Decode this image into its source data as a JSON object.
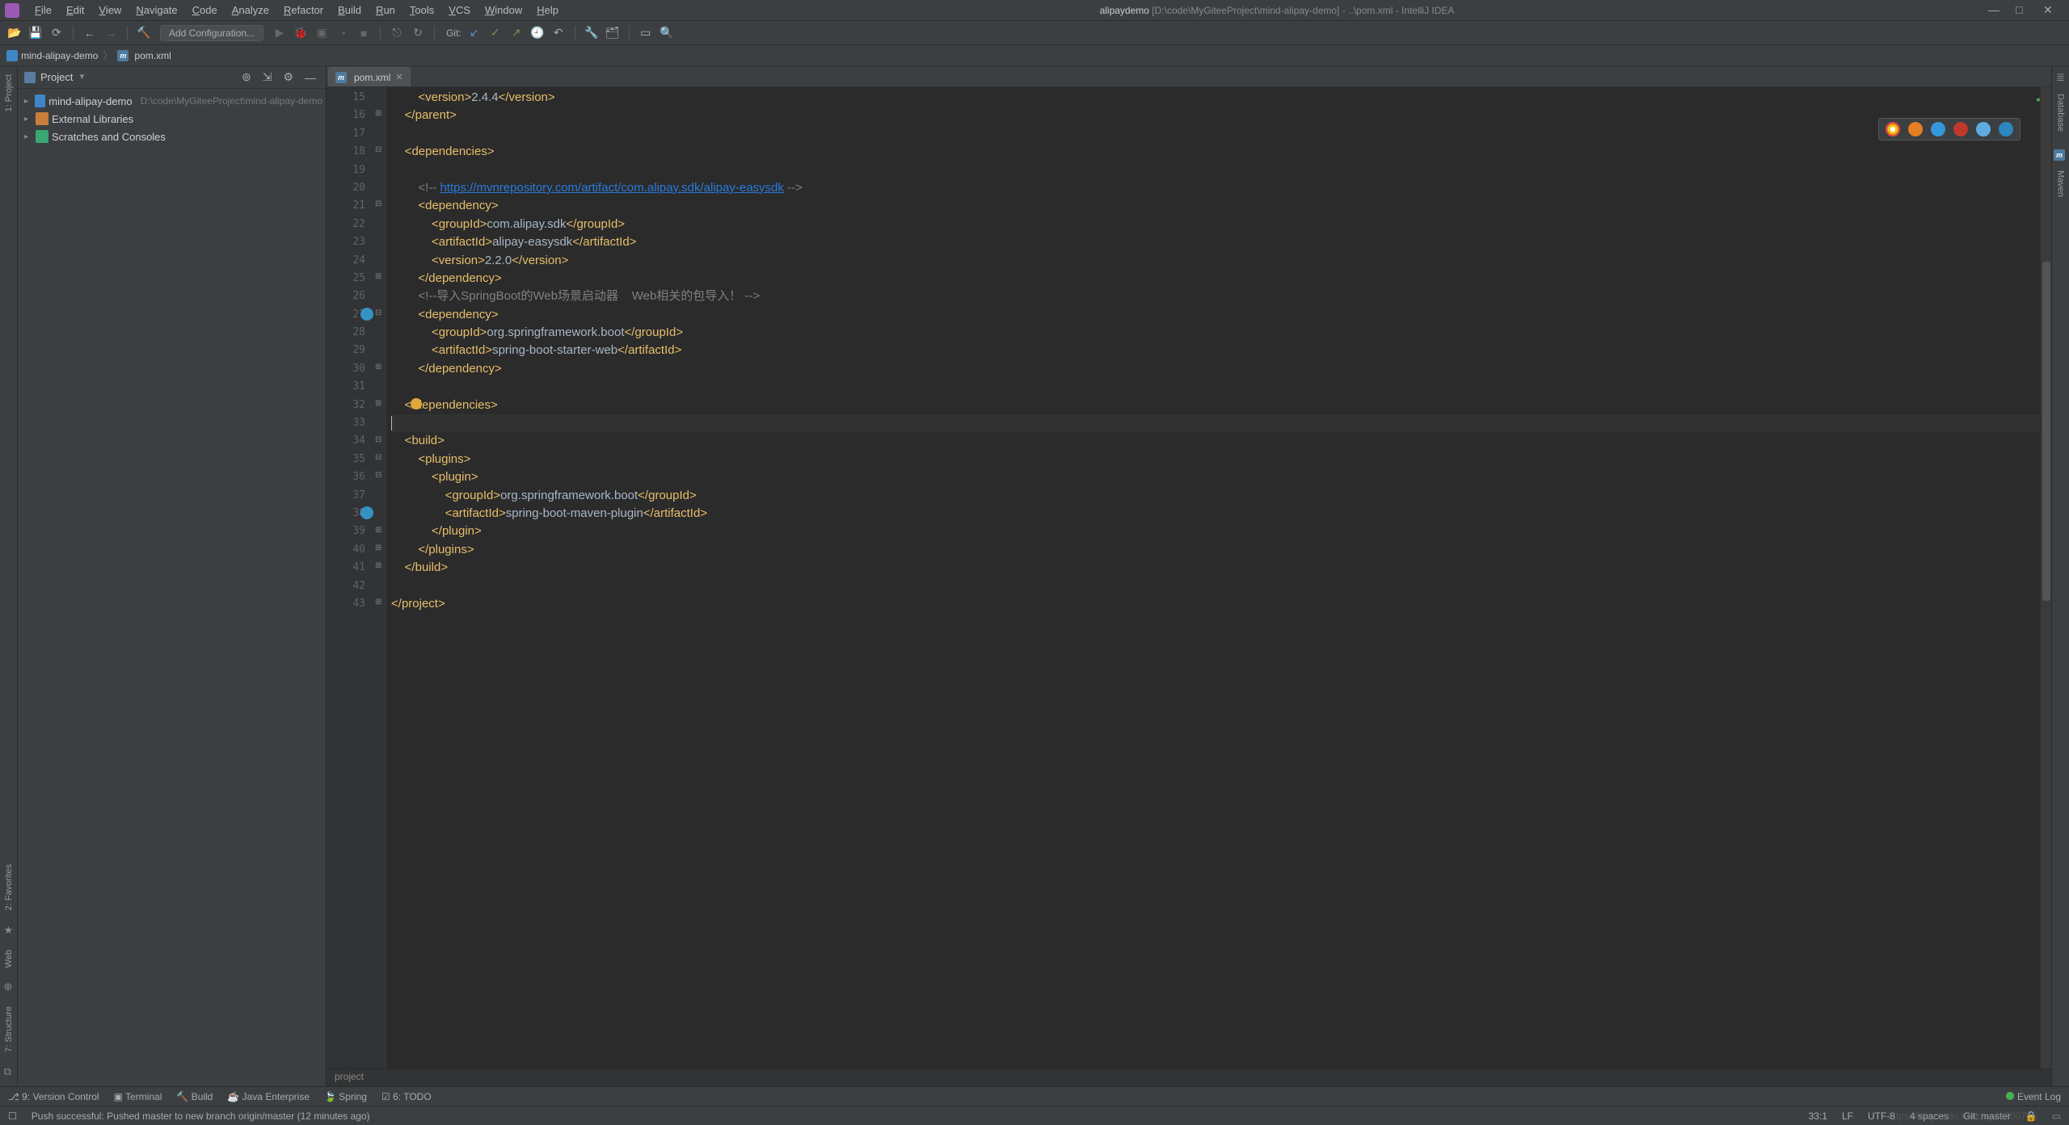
{
  "app": {
    "title_project": "alipaydemo",
    "title_path": "[D:\\code\\MyGiteeProject\\mind-alipay-demo] - ..\\pom.xml - IntelliJ IDEA"
  },
  "menu": [
    "File",
    "Edit",
    "View",
    "Navigate",
    "Code",
    "Analyze",
    "Refactor",
    "Build",
    "Run",
    "Tools",
    "VCS",
    "Window",
    "Help"
  ],
  "toolbar": {
    "run_config": "Add Configuration...",
    "git_label": "Git:"
  },
  "breadcrumb": {
    "project": "mind-alipay-demo",
    "file": "pom.xml"
  },
  "project_tw": {
    "title": "Project",
    "items": [
      {
        "name": "mind-alipay-demo",
        "path": "D:\\code\\MyGiteeProject\\mind-alipay-demo",
        "icon": "mod"
      },
      {
        "name": "External Libraries",
        "icon": "lib"
      },
      {
        "name": "Scratches and Consoles",
        "icon": "scr"
      }
    ]
  },
  "editor": {
    "tab": "pom.xml",
    "breadcrumb": "project",
    "first_line": 15,
    "current_line_idx": 18,
    "lines": [
      [
        8,
        "tag_open",
        "version",
        "2.4.4",
        "version",
        "tag_close"
      ],
      [
        4,
        "tag_close_only",
        "parent"
      ],
      [
        0,
        "blank"
      ],
      [
        4,
        "tag_open_only",
        "dependencies"
      ],
      [
        0,
        "blank"
      ],
      [
        8,
        "comment_link",
        "<!-- ",
        "https://mvnrepository.com/artifact/com.alipay.sdk/alipay-easysdk",
        " -->"
      ],
      [
        8,
        "tag_open_only",
        "dependency"
      ],
      [
        12,
        "tag_open",
        "groupId",
        "com.alipay.sdk",
        "groupId",
        "tag_close"
      ],
      [
        12,
        "tag_open",
        "artifactId",
        "alipay-easysdk",
        "artifactId",
        "tag_close"
      ],
      [
        12,
        "tag_open",
        "version",
        "2.2.0",
        "version",
        "tag_close"
      ],
      [
        8,
        "tag_close_only",
        "dependency"
      ],
      [
        8,
        "comment",
        "<!--导入SpringBoot的Web场景启动器    Web相关的包导入！ -->"
      ],
      [
        8,
        "tag_open_only",
        "dependency"
      ],
      [
        12,
        "tag_open",
        "groupId",
        "org.springframework.boot",
        "groupId",
        "tag_close"
      ],
      [
        12,
        "tag_open",
        "artifactId",
        "spring-boot-starter-web",
        "artifactId",
        "tag_close"
      ],
      [
        8,
        "tag_close_only",
        "dependency"
      ],
      [
        0,
        "blank"
      ],
      [
        4,
        "tag_close_only",
        "dependencies"
      ],
      [
        0,
        "caret"
      ],
      [
        4,
        "tag_open_only",
        "build"
      ],
      [
        8,
        "tag_open_only",
        "plugins"
      ],
      [
        12,
        "tag_open_only",
        "plugin"
      ],
      [
        16,
        "tag_open",
        "groupId",
        "org.springframework.boot",
        "groupId",
        "tag_close"
      ],
      [
        16,
        "tag_open",
        "artifactId",
        "spring-boot-maven-plugin",
        "artifactId",
        "tag_close"
      ],
      [
        12,
        "tag_close_only",
        "plugin"
      ],
      [
        8,
        "tag_close_only",
        "plugins"
      ],
      [
        4,
        "tag_close_only",
        "build"
      ],
      [
        0,
        "blank"
      ],
      [
        0,
        "tag_close_only",
        "project"
      ]
    ]
  },
  "left_strip": {
    "top": "1: Project",
    "fav": "2: Favorites",
    "web": "Web",
    "struct": "7: Structure"
  },
  "right_strip": {
    "db": "Database",
    "mvn": "Maven"
  },
  "bottom_tools": {
    "items": [
      "9: Version Control",
      "Terminal",
      "Build",
      "Java Enterprise",
      "Spring",
      "6: TODO"
    ],
    "event_log": "Event Log"
  },
  "status": {
    "message": "Push successful: Pushed master to new branch origin/master (12 minutes ago)",
    "pos": "33:1",
    "le": "LF",
    "enc": "UTF-8",
    "indent": "4 spaces",
    "branch": "Git: master"
  },
  "watermark": "https://blog.csdn.net/qq_40700766"
}
